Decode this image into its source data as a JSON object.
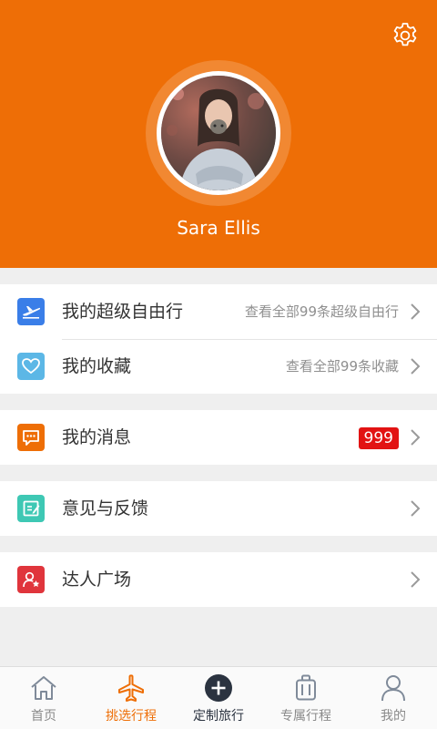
{
  "profile": {
    "name": "Sara Ellis"
  },
  "menu": {
    "group1": [
      {
        "label": "我的超级自由行",
        "hint": "查看全部99条超级自由行",
        "icon": "airplane-icon",
        "color": "#3a7ee8"
      },
      {
        "label": "我的收藏",
        "hint": "查看全部99条收藏",
        "icon": "heart-icon",
        "color": "#5cb7e6"
      }
    ],
    "group2": [
      {
        "label": "我的消息",
        "badge": "999",
        "icon": "message-icon",
        "color": "#ee6e06"
      }
    ],
    "group3": [
      {
        "label": "意见与反馈",
        "icon": "feedback-icon",
        "color": "#3ec8b4"
      }
    ],
    "group4": [
      {
        "label": "达人广场",
        "icon": "expert-icon",
        "color": "#e0353c"
      }
    ]
  },
  "tabs": [
    {
      "label": "首页",
      "icon": "home-icon"
    },
    {
      "label": "挑选行程",
      "icon": "plane-icon",
      "active": true
    },
    {
      "label": "定制旅行",
      "icon": "plus-circle-icon"
    },
    {
      "label": "专属行程",
      "icon": "luggage-icon"
    },
    {
      "label": "我的",
      "icon": "user-icon"
    }
  ],
  "colors": {
    "header": "#ee6e06",
    "accent": "#ee6e06",
    "badge": "#e21313"
  }
}
